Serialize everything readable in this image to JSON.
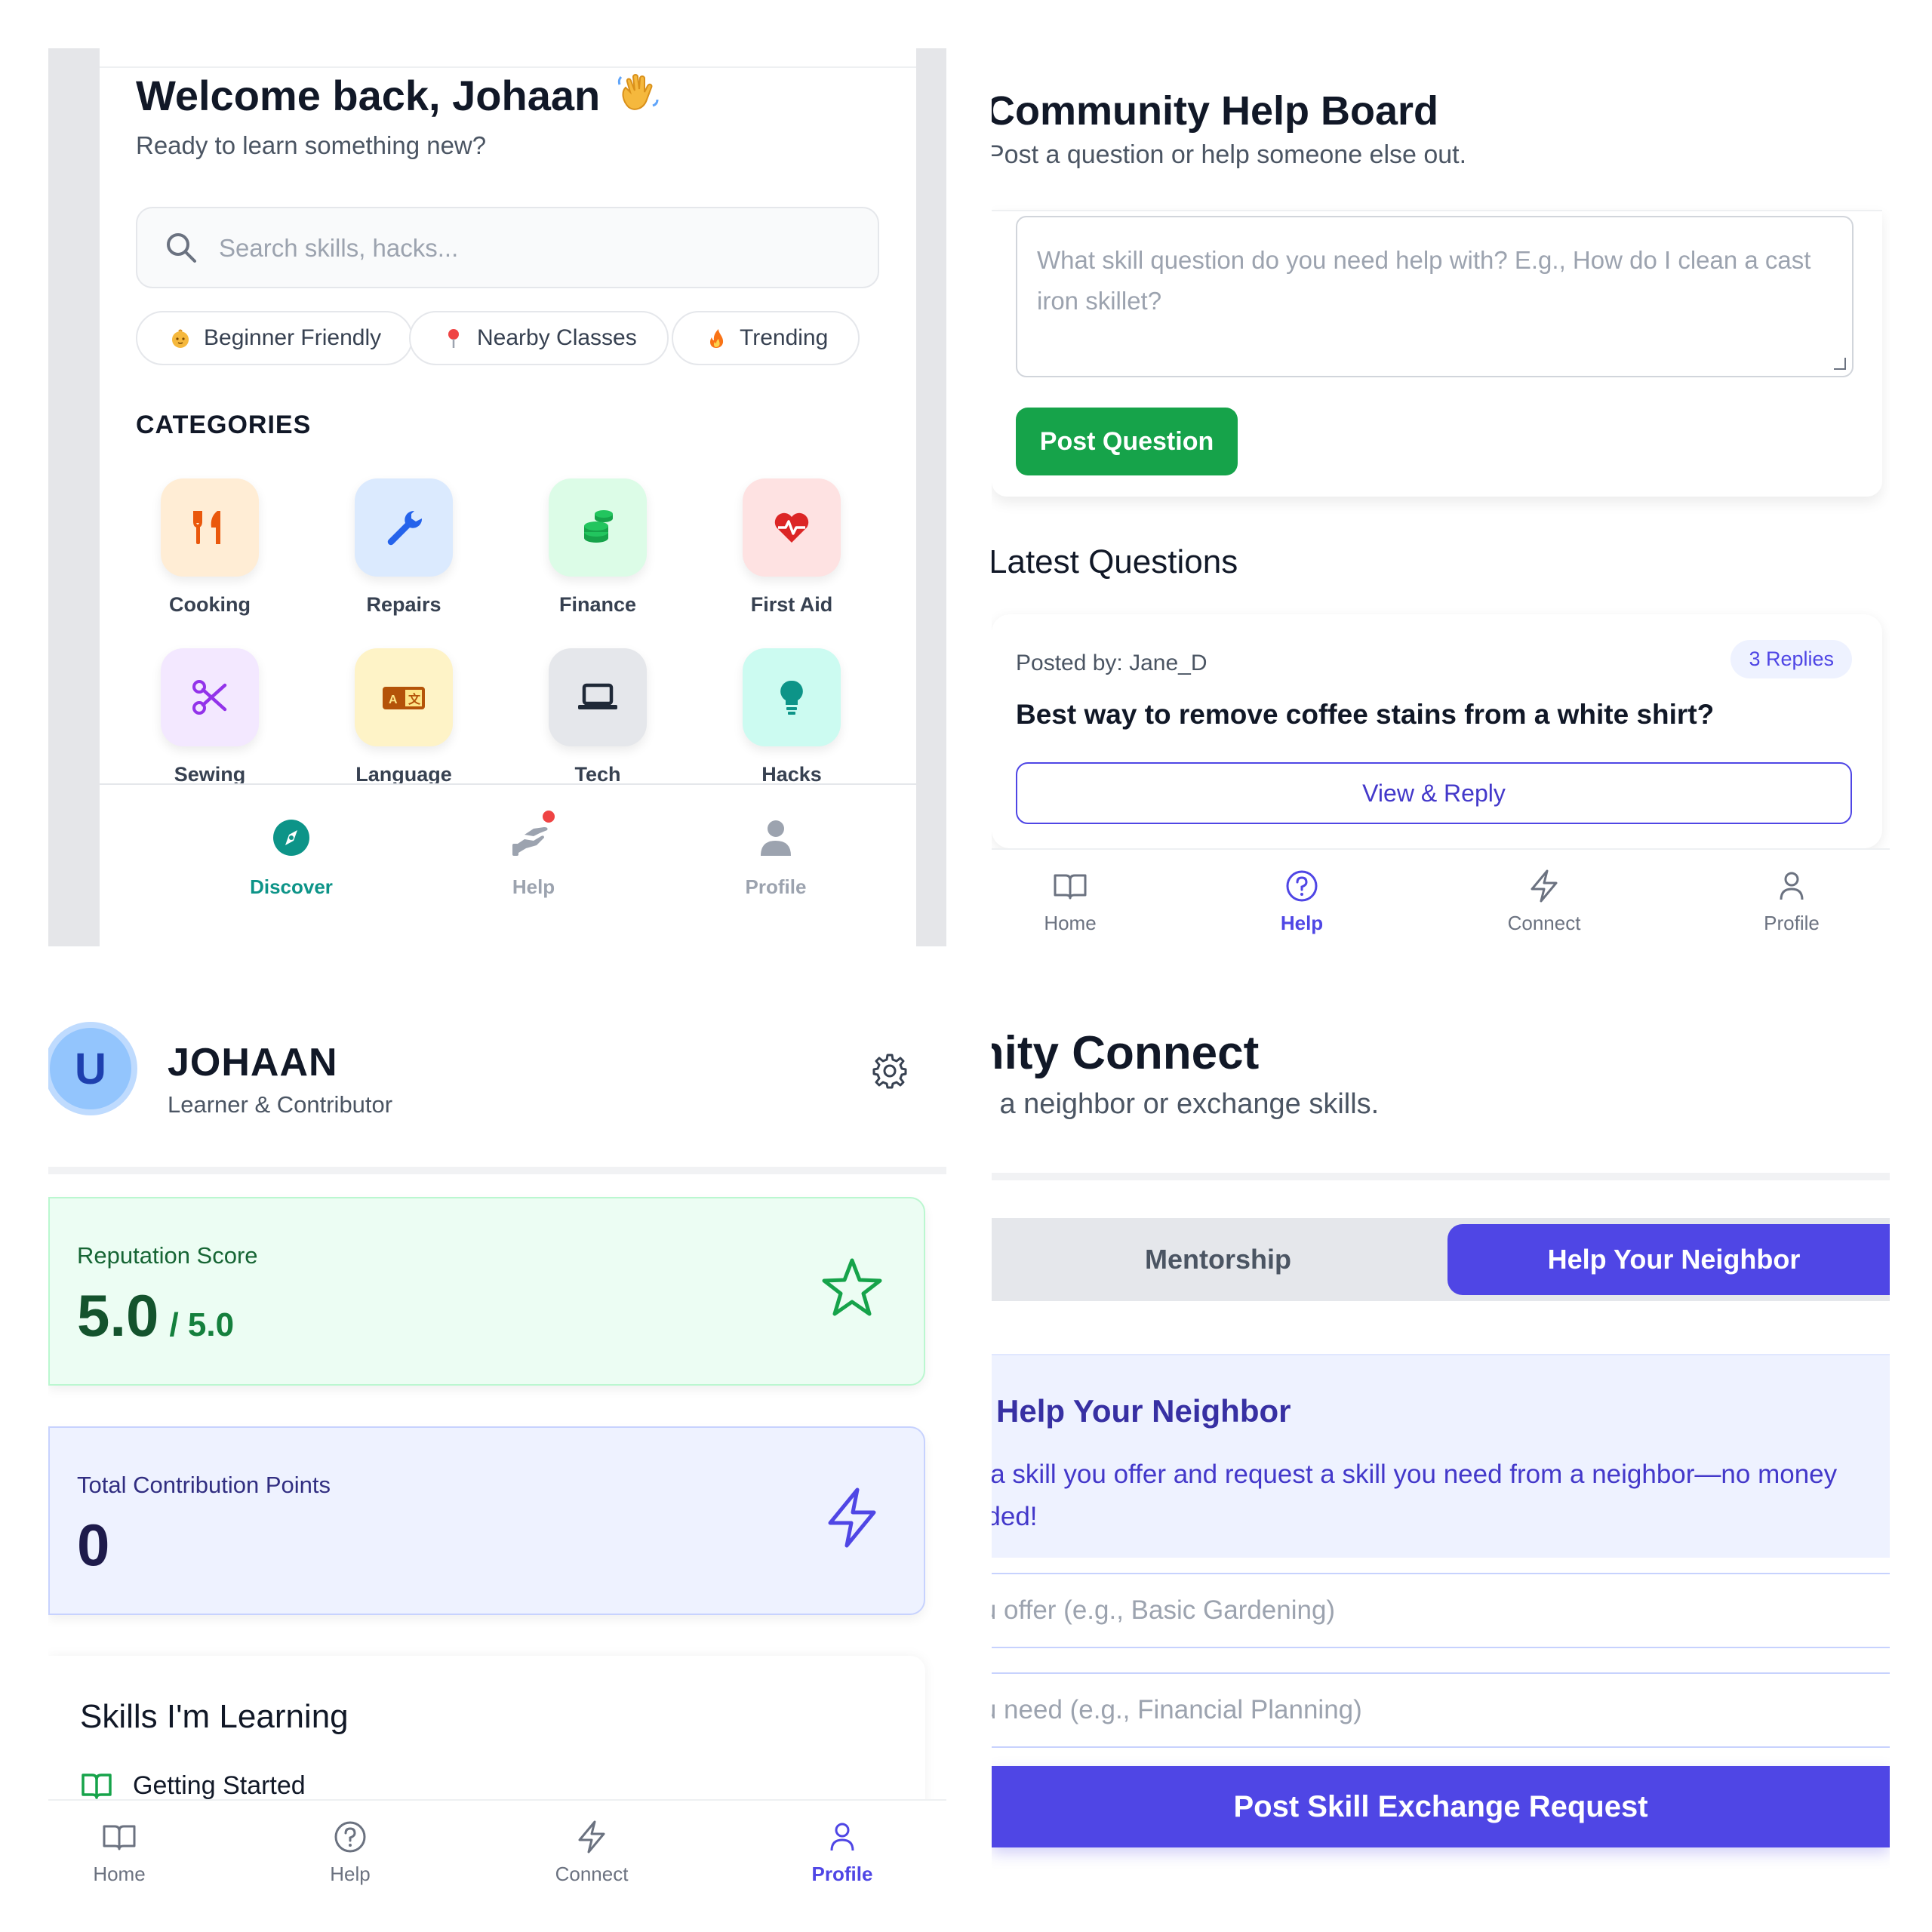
{
  "discover": {
    "welcome": "Welcome back, Johaan",
    "subtitle": "Ready to learn something new?",
    "search_placeholder": "Search skills, hacks...",
    "chips": [
      {
        "label": "Beginner Friendly",
        "icon": "baby-icon"
      },
      {
        "label": "Nearby Classes",
        "icon": "pin-icon"
      },
      {
        "label": "Trending",
        "icon": "fire-icon"
      }
    ],
    "categories_title": "CATEGORIES",
    "categories": [
      {
        "label": "Cooking",
        "icon": "utensils-icon"
      },
      {
        "label": "Repairs",
        "icon": "wrench-icon"
      },
      {
        "label": "Finance",
        "icon": "coins-icon"
      },
      {
        "label": "First Aid",
        "icon": "heartbeat-icon"
      },
      {
        "label": "Sewing",
        "icon": "scissors-icon"
      },
      {
        "label": "Language",
        "icon": "language-icon"
      },
      {
        "label": "Tech",
        "icon": "laptop-icon"
      },
      {
        "label": "Hacks",
        "icon": "lightbulb-icon"
      }
    ],
    "nav": [
      {
        "label": "Discover",
        "icon": "compass-icon",
        "active": true
      },
      {
        "label": "Help",
        "icon": "helping-hand-icon",
        "active": false
      },
      {
        "label": "Profile",
        "icon": "user-icon",
        "active": false
      }
    ]
  },
  "help_board": {
    "title": "Community Help Board",
    "subtitle": "Post a question or help someone else out.",
    "question_placeholder": "What skill question do you need help with? E.g., How do I clean a cast iron skillet?",
    "post_button": "Post Question",
    "latest_title": "Latest Questions",
    "question": {
      "posted_by": "Posted by: Jane_D",
      "replies": "3 Replies",
      "text": "Best way to remove coffee stains from a white shirt?",
      "action": "View & Reply"
    },
    "nav": [
      {
        "label": "Home",
        "icon": "book-icon"
      },
      {
        "label": "Help",
        "icon": "help-circle-icon",
        "active": true
      },
      {
        "label": "Connect",
        "icon": "bolt-icon"
      },
      {
        "label": "Profile",
        "icon": "user-icon"
      }
    ]
  },
  "profile": {
    "avatar_letter": "U",
    "name": "JOHAAN",
    "role": "Learner & Contributor",
    "reputation_label": "Reputation Score",
    "reputation_value": "5.0",
    "reputation_max": "/ 5.0",
    "points_label": "Total Contribution Points",
    "points_value": "0",
    "skills_title": "Skills I'm Learning",
    "skills_first": "Getting Started",
    "nav": [
      {
        "label": "Home",
        "icon": "book-icon"
      },
      {
        "label": "Help",
        "icon": "help-circle-icon"
      },
      {
        "label": "Connect",
        "icon": "bolt-icon"
      },
      {
        "label": "Profile",
        "icon": "user-icon",
        "active": true
      }
    ]
  },
  "connect": {
    "title": "Community Connect",
    "subtitle": "Find a neighbor or exchange skills.",
    "tabs": [
      "Mentorship",
      "Help Your Neighbor"
    ],
    "section_title": "Help Your Neighbor",
    "section_desc": "List a skill you offer and request a skill you need from a neighbor—no money needed!",
    "offer_placeholder": "Skill you offer (e.g., Basic Gardening)",
    "need_placeholder": "Skill you need (e.g., Financial Planning)",
    "submit": "Post Skill Exchange Request"
  },
  "colors": {
    "accent": "#4f46e5",
    "teal": "#0d9488",
    "green": "#16a34a"
  }
}
